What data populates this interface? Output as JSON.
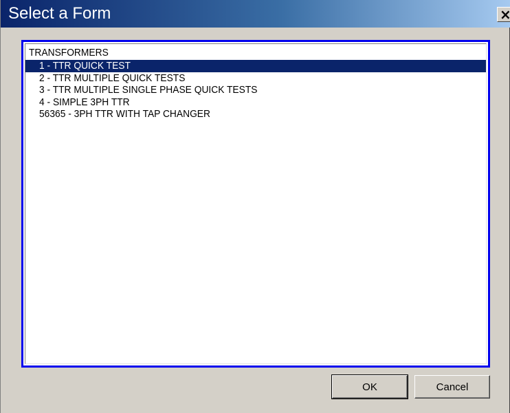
{
  "window": {
    "title": "Select a Form",
    "close_glyph": "×",
    "close_icon": "close-icon"
  },
  "list": {
    "group_label": "TRANSFORMERS",
    "selected_index": 0,
    "items": [
      {
        "label": "1 - TTR QUICK TEST",
        "selected": true
      },
      {
        "label": "2 - TTR MULTIPLE QUICK TESTS",
        "selected": false
      },
      {
        "label": "3 - TTR MULTIPLE SINGLE PHASE QUICK TESTS",
        "selected": false
      },
      {
        "label": "4 - SIMPLE 3PH TTR",
        "selected": false
      },
      {
        "label": "56365 - 3PH TTR WITH TAP CHANGER",
        "selected": false
      }
    ]
  },
  "buttons": {
    "ok_label": "OK",
    "cancel_label": "Cancel"
  },
  "colors": {
    "titlebar_start": "#0a246a",
    "titlebar_end": "#a6caf0",
    "selection": "#0a246a",
    "focus_border": "#0000ee",
    "dialog_face": "#d4d0c8"
  }
}
